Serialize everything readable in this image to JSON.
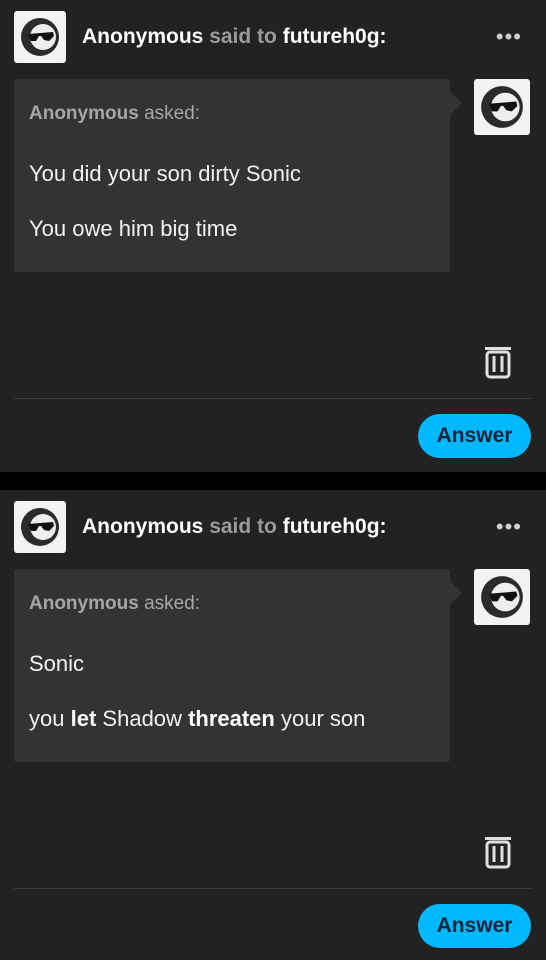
{
  "cards": [
    {
      "sender": "Anonymous",
      "said_to": "said to",
      "recipient": "futureh0g:",
      "more_icon": "more-dots-icon",
      "asked_name": "Anonymous",
      "asked_label": "asked:",
      "line1": "You did your son dirty Sonic",
      "line2": "You owe him big time",
      "delete_icon": "trash-icon",
      "answer_label": "Answer"
    },
    {
      "sender": "Anonymous",
      "said_to": "said to",
      "recipient": "futureh0g:",
      "more_icon": "more-dots-icon",
      "asked_name": "Anonymous",
      "asked_label": "asked:",
      "line1": "Sonic",
      "line2_parts": [
        "you",
        "let",
        "Shadow",
        "threaten",
        "your son"
      ],
      "delete_icon": "trash-icon",
      "answer_label": "Answer"
    }
  ],
  "colors": {
    "background": "#222222",
    "bubble": "#333333",
    "answer_button": "#00b8ff",
    "muted_text": "#9a9a9a"
  }
}
